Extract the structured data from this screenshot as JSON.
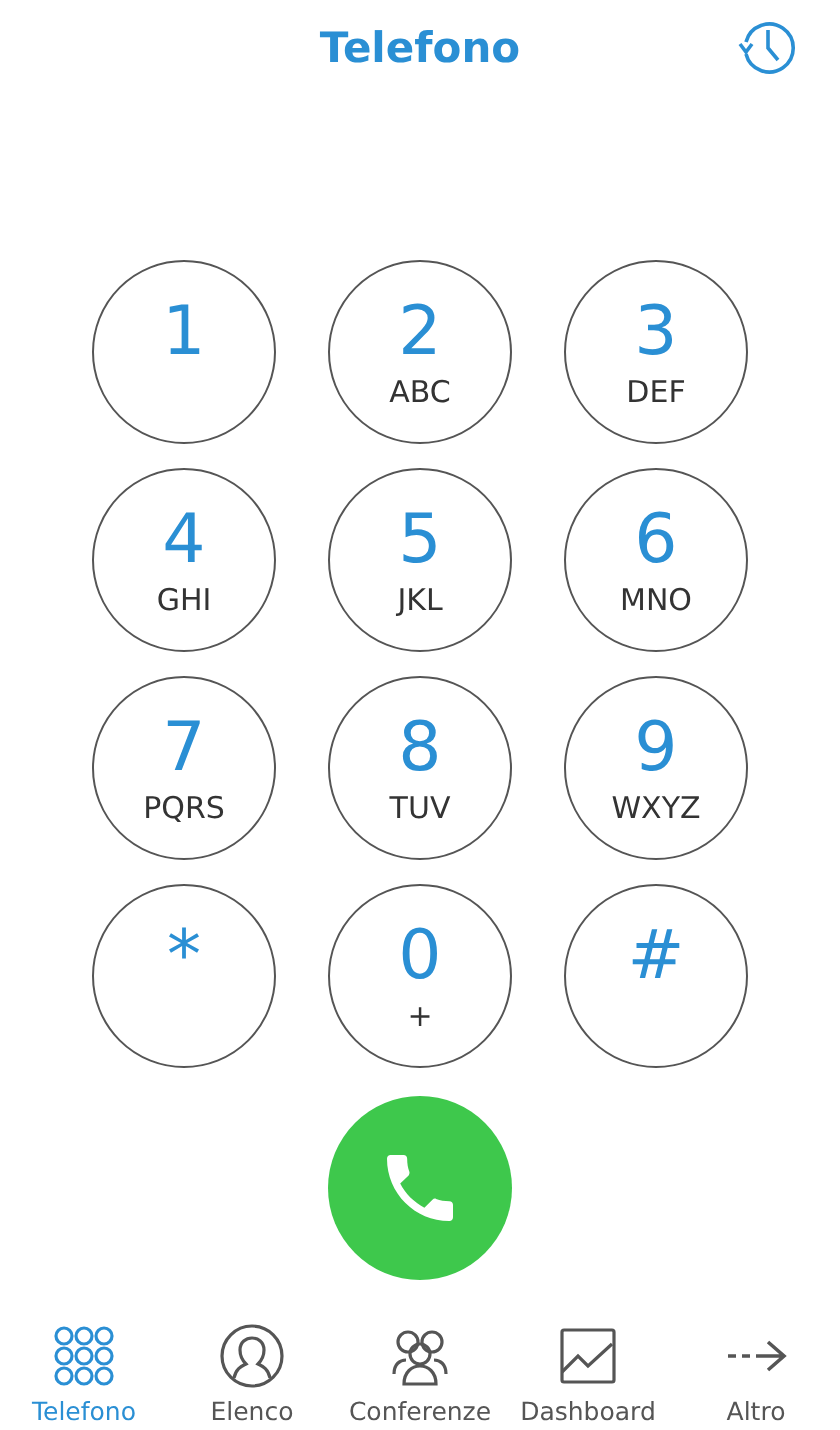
{
  "header": {
    "title": "Telefono"
  },
  "keys": [
    {
      "digit": "1"
    },
    {
      "digit": "2",
      "letters": "ABC"
    },
    {
      "digit": "3",
      "letters": "DEF"
    },
    {
      "digit": "4",
      "letters": "GHI"
    },
    {
      "digit": "5",
      "letters": "JKL"
    },
    {
      "digit": "6",
      "letters": "MNO"
    },
    {
      "digit": "7",
      "letters": "PQRS"
    },
    {
      "digit": "8",
      "letters": "TUV"
    },
    {
      "digit": "9",
      "letters": "WXYZ"
    },
    {
      "digit": "*"
    },
    {
      "digit": "0",
      "letters": "+"
    },
    {
      "digit": "#"
    }
  ],
  "tabs": [
    {
      "label": "Telefono",
      "kind": "dialpad",
      "selected": true
    },
    {
      "label": "Elenco",
      "kind": "contact",
      "selected": false
    },
    {
      "label": "Conferenze",
      "kind": "group",
      "selected": false
    },
    {
      "label": "Dashboard",
      "kind": "chart",
      "selected": false
    },
    {
      "label": "Altro",
      "kind": "more",
      "selected": false
    }
  ]
}
